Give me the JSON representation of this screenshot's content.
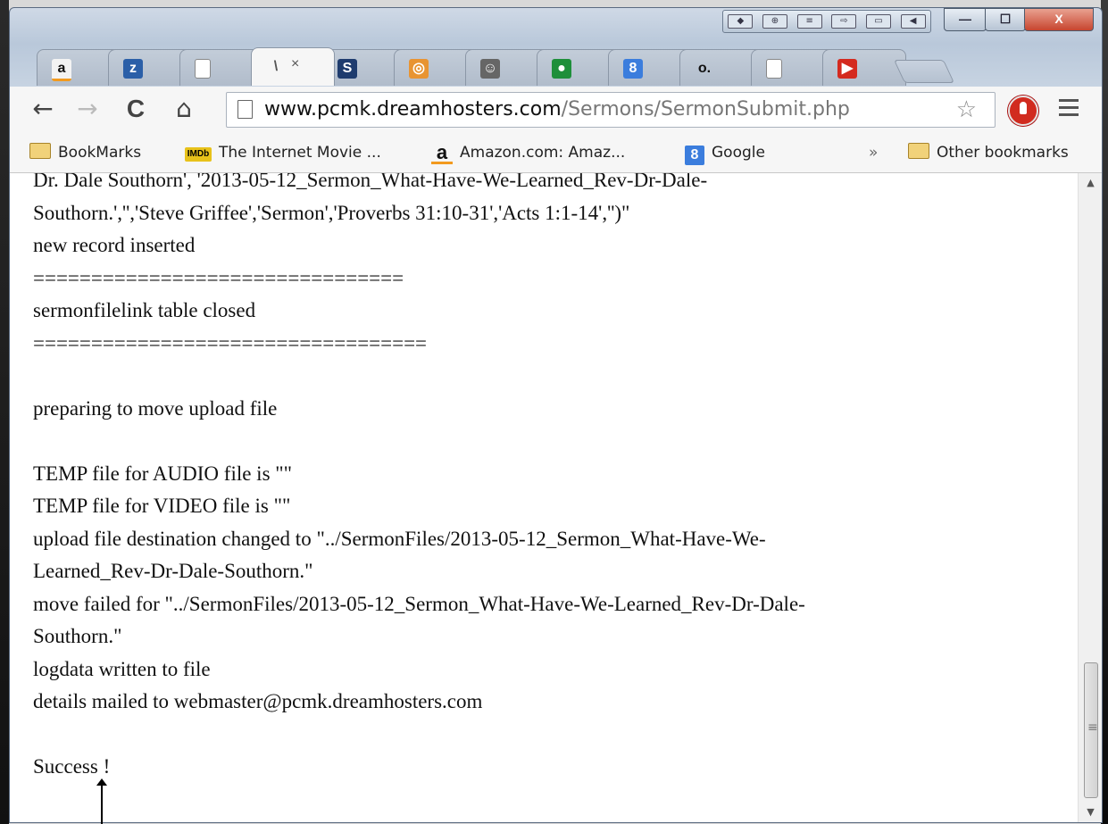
{
  "browser": {
    "tabs": [
      {
        "icon": "amazon-icon",
        "glyph": "a",
        "color": "#f3f3f3"
      },
      {
        "icon": "zotero-icon",
        "glyph": "z",
        "color": "#2b5fa8"
      },
      {
        "icon": "blank-page-icon",
        "glyph": "",
        "color": "#ffffff"
      },
      {
        "icon": "loading-icon",
        "glyph": "\\",
        "color": "#ffffff",
        "active": true,
        "close": "×"
      },
      {
        "icon": "scribd-icon",
        "glyph": "S",
        "color": "#1f3c6e"
      },
      {
        "icon": "swirl-icon",
        "glyph": "◎",
        "color": "#e89432"
      },
      {
        "icon": "mailchimp-icon",
        "glyph": "☺",
        "color": "#666666"
      },
      {
        "icon": "green-circle-icon",
        "glyph": "●",
        "color": "#1e8f3a"
      },
      {
        "icon": "google-icon",
        "glyph": "8",
        "color": "#3b7ddd"
      },
      {
        "icon": "dot-app-icon",
        "glyph": "o.",
        "color": "#111111"
      },
      {
        "icon": "blank-page-icon",
        "glyph": "",
        "color": "#ffffff"
      },
      {
        "icon": "youtube-icon",
        "glyph": "▶",
        "color": "#d42a1f"
      }
    ],
    "window_controls": {
      "minimize": "—",
      "maximize": "☐",
      "close": "X"
    },
    "nav": {
      "back": "←",
      "forward": "→",
      "reload": "C",
      "home": "⌂"
    },
    "url_host": "www.pcmk.dreamhosters.com",
    "url_path": "/Sermons/SermonSubmit.php",
    "star": "☆",
    "bookmarks": {
      "bookmarks_folder": "BookMarks",
      "imdb_badge": "IMDb",
      "imdb": "The Internet Movie ...",
      "amazon": "Amazon.com: Amaz...",
      "google": "Google",
      "overflow": "»",
      "other": "Other bookmarks"
    }
  },
  "log_lines": [
    "Dr. Dale Southorn', '2013-05-12_Sermon_What-Have-We-Learned_Rev-Dr-Dale-",
    "Southorn.','','Steve Griffee','Sermon','Proverbs 31:10-31','Acts 1:1-14','')\"",
    "new record inserted",
    "================================",
    "sermonfilelink table closed",
    "==================================",
    "",
    "preparing to move upload file",
    "",
    "TEMP file for AUDIO file is \"\"",
    "TEMP file for VIDEO file is \"\"",
    "upload file destination changed to \"../SermonFiles/2013-05-12_Sermon_What-Have-We-",
    "Learned_Rev-Dr-Dale-Southorn.\"",
    "move failed for \"../SermonFiles/2013-05-12_Sermon_What-Have-We-Learned_Rev-Dr-Dale-",
    "Southorn.\"",
    "logdata written to file",
    "details mailed to webmaster@pcmk.dreamhosters.com",
    "",
    "Success !"
  ],
  "scrollbar": {
    "up": "▲",
    "down": "▼",
    "grip": "≡"
  }
}
